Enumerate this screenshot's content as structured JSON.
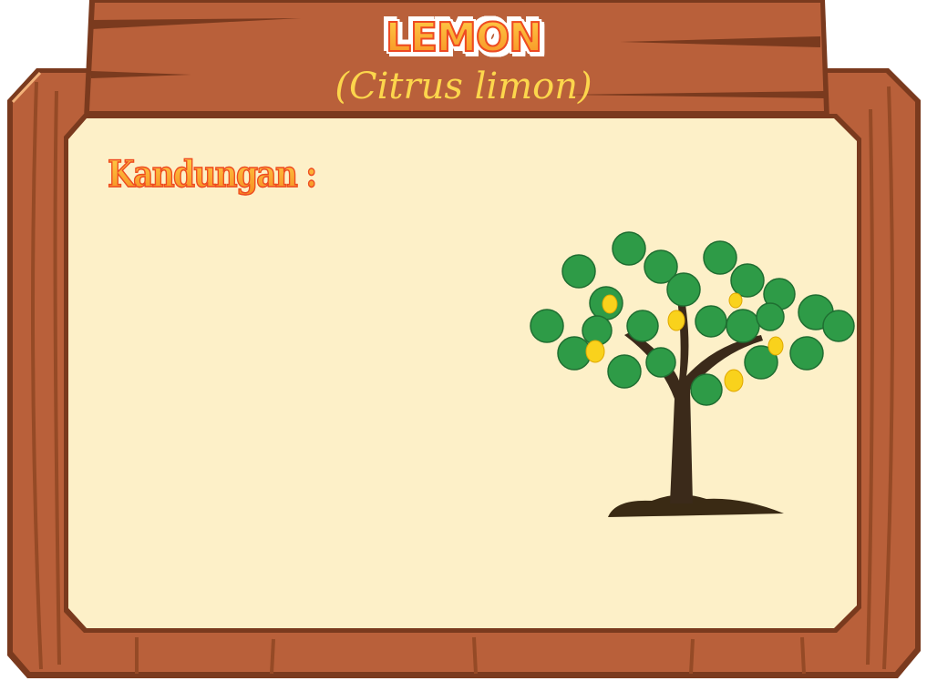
{
  "header": {
    "title": "LEMON",
    "scientific_name": "(Citrus limon)"
  },
  "content": {
    "heading": "Kandungan :"
  },
  "colors": {
    "wood": "#b9603a",
    "wood_dark": "#7a3a1e",
    "panel": "#fdf0c8",
    "title_orange": "#f68a1f",
    "title_yellow": "#fcd64c",
    "leaf": "#2e9b47",
    "lemon_fruit": "#f9d21c"
  }
}
